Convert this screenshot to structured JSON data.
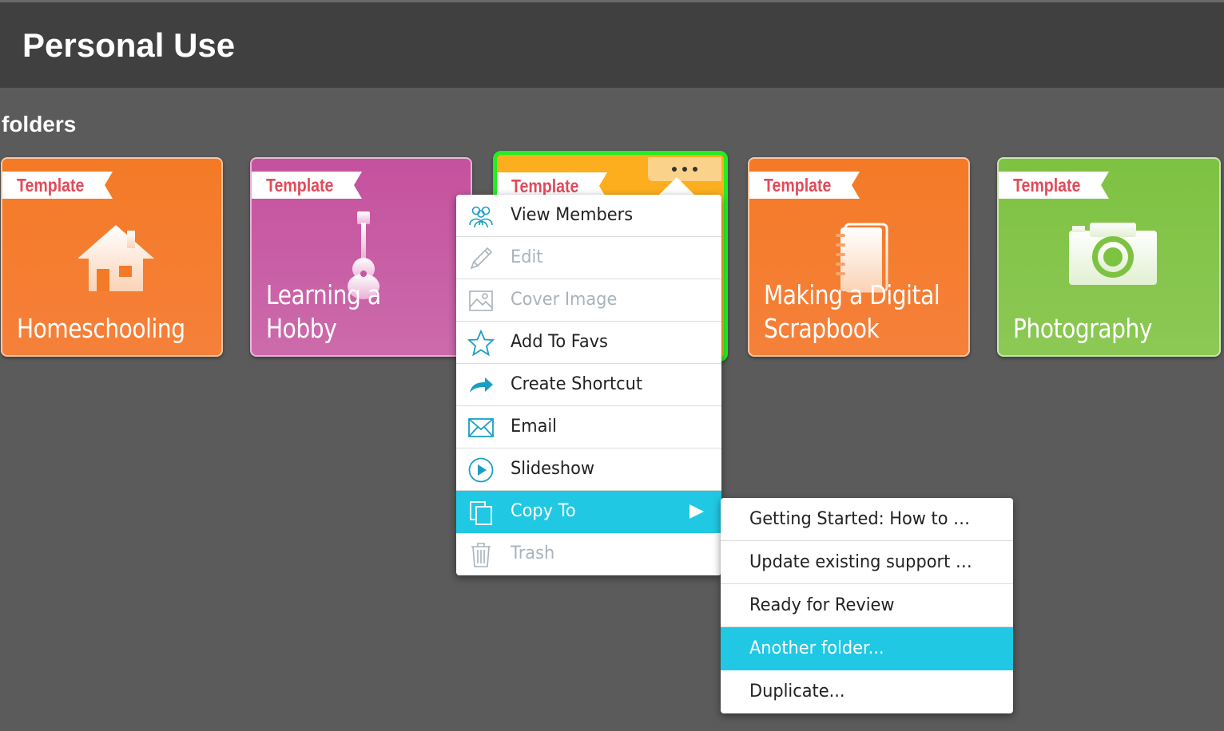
{
  "header": {
    "title": "Personal Use"
  },
  "section": {
    "label": "folders"
  },
  "colors": {
    "orange": "#f47a28",
    "magenta": "#c857a0",
    "amber": "#fcae1e",
    "green": "#7ec242",
    "selection_border": "#22ee22",
    "menu_accent": "#20c8e4",
    "ribbon_text": "#e14b5a"
  },
  "tiles": [
    {
      "label_line1": "",
      "label_line2": "Homeschooling",
      "badge": "Template",
      "icon": "house-icon",
      "color": "orange"
    },
    {
      "label_line1": "Learning a",
      "label_line2": "Hobby",
      "badge": "Template",
      "icon": "guitar-icon",
      "color": "magenta"
    },
    {
      "label_line1": "",
      "label_line2": "",
      "badge": "Template",
      "icon": "more-options-icon",
      "color": "amber",
      "selected": true
    },
    {
      "label_line1": "Making a Digital",
      "label_line2": "Scrapbook",
      "badge": "Template",
      "icon": "notebook-icon",
      "color": "orange"
    },
    {
      "label_line1": "",
      "label_line2": "Photography",
      "badge": "Template",
      "icon": "camera-icon",
      "color": "green"
    }
  ],
  "context_menu": {
    "items": [
      {
        "label": "View Members",
        "icon": "members-icon",
        "enabled": true
      },
      {
        "label": "Edit",
        "icon": "pencil-icon",
        "enabled": false
      },
      {
        "label": "Cover Image",
        "icon": "image-icon",
        "enabled": false
      },
      {
        "label": "Add To Favs",
        "icon": "star-icon",
        "enabled": true
      },
      {
        "label": "Create Shortcut",
        "icon": "arrow-right-icon",
        "enabled": true
      },
      {
        "label": "Email",
        "icon": "envelope-icon",
        "enabled": true
      },
      {
        "label": "Slideshow",
        "icon": "play-icon",
        "enabled": true
      },
      {
        "label": "Copy To",
        "icon": "copy-icon",
        "enabled": true,
        "active": true,
        "has_submenu": true
      },
      {
        "label": "Trash",
        "icon": "trash-icon",
        "enabled": false
      }
    ]
  },
  "copy_submenu": {
    "items": [
      {
        "label": "Getting Started: How to …"
      },
      {
        "label": "Update existing support …"
      },
      {
        "label": "Ready for Review"
      },
      {
        "label": "Another folder...",
        "active": true
      },
      {
        "label": "Duplicate..."
      }
    ]
  }
}
